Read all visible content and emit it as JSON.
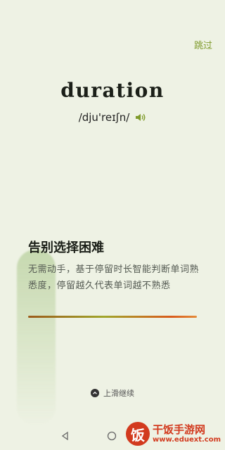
{
  "header": {
    "skip_label": "跳过"
  },
  "word": {
    "text": "duration",
    "phonetic": "/dju'reɪʃn/",
    "speaker_icon": "speaker-icon"
  },
  "card": {
    "title": "告别选择困难",
    "description": "无需动手，基于停留时长智能判断单词熟悉度，停留越久代表单词越不熟悉",
    "progress": 1.0
  },
  "swipe": {
    "label": "上滑继续",
    "icon": "chevron-up-icon"
  },
  "colors": {
    "accent": "#7f9b2b",
    "background": "#eef2e4",
    "watermark": "#d23a1e"
  },
  "watermark": {
    "seal": "饭",
    "name": "干饭手游网",
    "url": "www.eduext.com"
  }
}
